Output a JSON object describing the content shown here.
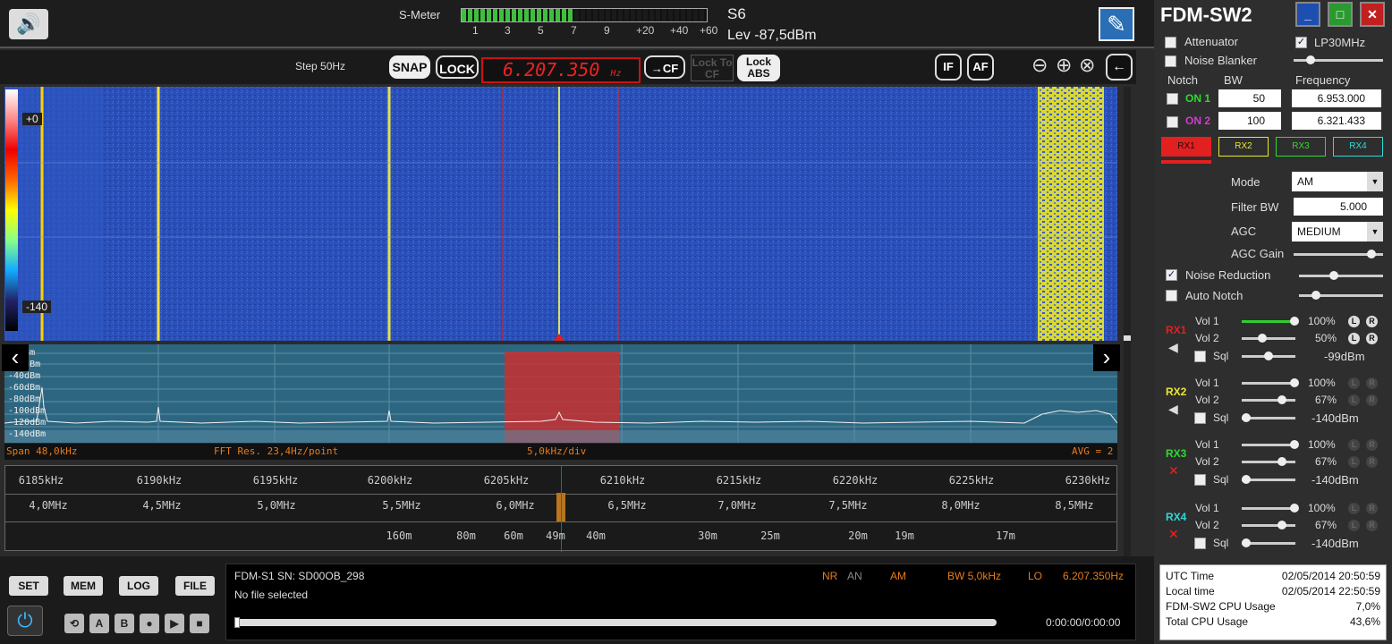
{
  "top": {
    "smeter_label": "S-Meter",
    "smeter_scale": [
      "1",
      "3",
      "5",
      "7",
      "9",
      "+20",
      "+40",
      "+60"
    ],
    "smeter_segments_lit": 18,
    "s_reading": "S6",
    "level": "Lev -87,5dBm"
  },
  "controls": {
    "step": "Step 50Hz",
    "snap": "SNAP",
    "lock": "LOCK",
    "frequency": "6.207.350",
    "frequency_unit": "Hz",
    "to_cf": "→CF",
    "lock_to_cf": "Lock To CF",
    "lock_abs": "Lock ABS",
    "if_btn": "IF",
    "af_btn": "AF"
  },
  "waterfall": {
    "top_db": "+0",
    "bottom_db": "-140"
  },
  "spectrum": {
    "db_labels": [
      "-0dBm",
      "-20dBm",
      "-40dBm",
      "-60dBm",
      "-80dBm",
      "-100dBm",
      "-120dBm",
      "-140dBm"
    ],
    "span": "Span 48,0kHz",
    "fft_res": "FFT Res. 23,4Hz/point",
    "div": "5,0kHz/div",
    "avg": "AVG = 2"
  },
  "scale": {
    "khz": [
      "6185kHz",
      "6190kHz",
      "6195kHz",
      "6200kHz",
      "6205kHz",
      "6210kHz",
      "6215kHz",
      "6220kHz",
      "6225kHz",
      "6230kHz"
    ],
    "mhz": [
      "4,0MHz",
      "4,5MHz",
      "5,0MHz",
      "5,5MHz",
      "6,0MHz",
      "6,5MHz",
      "7,0MHz",
      "7,5MHz",
      "8,0MHz",
      "8,5MHz"
    ],
    "bands": [
      "160m",
      "80m",
      "60m",
      "49m",
      "40m",
      "30m",
      "25m",
      "20m",
      "19m",
      "17m"
    ]
  },
  "bottom": {
    "set": "SET",
    "mem": "MEM",
    "log": "LOG",
    "file": "FILE",
    "device": "FDM-S1 SN: SD00OB_298",
    "file_status": "No file selected",
    "nr": "NR",
    "an": "AN",
    "mode": "AM",
    "bw": "BW 5,0kHz",
    "lo_label": "LO",
    "lo_value": "6.207.350Hz",
    "time": "0:00:00/0:00:00",
    "play_buttons": [
      "A",
      "B",
      "●",
      "▶",
      "■"
    ]
  },
  "panel": {
    "title": "FDM-SW2",
    "attenuator": "Attenuator",
    "lp30": "LP30MHz",
    "noise_blanker": "Noise Blanker",
    "notch": "Notch",
    "bw": "BW",
    "frequency": "Frequency",
    "on1": "ON 1",
    "on2": "ON 2",
    "notch1_bw": "50",
    "notch2_bw": "100",
    "notch1_freq": "6.953.000",
    "notch2_freq": "6.321.433",
    "rx_tabs": [
      "RX1",
      "RX2",
      "RX3",
      "RX4"
    ],
    "mode_label": "Mode",
    "mode_value": "AM",
    "filter_bw_label": "Filter BW",
    "filter_bw_value": "5.000",
    "agc_label": "AGC",
    "agc_value": "MEDIUM",
    "agc_gain": "AGC Gain",
    "noise_reduction": "Noise Reduction",
    "auto_notch": "Auto Notch",
    "rx": [
      {
        "label": "RX1",
        "vol1": "100%",
        "vol2": "50%",
        "sql": "-99dBm",
        "color": "#e22020"
      },
      {
        "label": "RX2",
        "vol1": "100%",
        "vol2": "67%",
        "sql": "-140dBm",
        "color": "#e8e830"
      },
      {
        "label": "RX3",
        "vol1": "100%",
        "vol2": "67%",
        "sql": "-140dBm",
        "color": "#30d830"
      },
      {
        "label": "RX4",
        "vol1": "100%",
        "vol2": "67%",
        "sql": "-140dBm",
        "color": "#30d8d8"
      }
    ],
    "vol1_label": "Vol 1",
    "vol2_label": "Vol 2",
    "sql_label": "Sql",
    "info": {
      "utc_label": "UTC Time",
      "utc_value": "02/05/2014 20:50:59",
      "local_label": "Local time",
      "local_value": "02/05/2014 22:50:59",
      "app_cpu_label": "FDM-SW2 CPU Usage",
      "app_cpu_value": "7,0%",
      "total_cpu_label": "Total CPU Usage",
      "total_cpu_value": "43,6%"
    }
  }
}
